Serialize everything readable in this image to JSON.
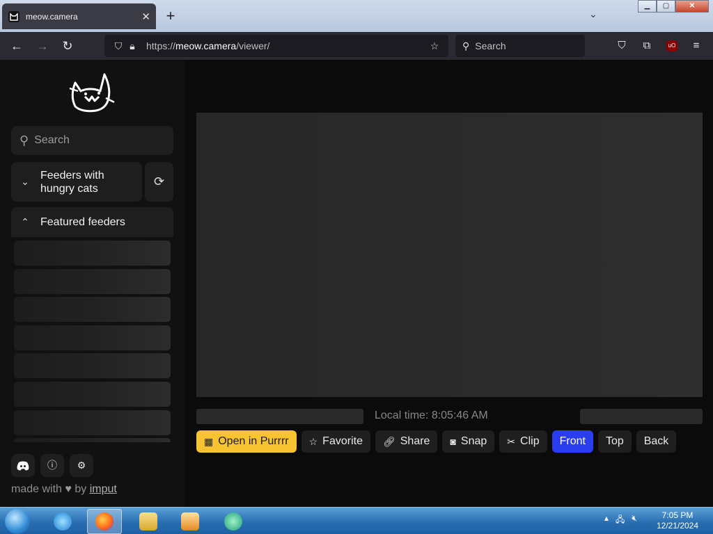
{
  "browser": {
    "tab_title": "meow.camera",
    "url_scheme": "https://",
    "url_host": "meow.camera",
    "url_path": "/viewer/",
    "search_placeholder": "Search"
  },
  "sidebar": {
    "search_placeholder": "Search",
    "sections": [
      {
        "label": "Feeders with hungry cats",
        "expanded": false
      },
      {
        "label": "Featured feeders",
        "expanded": true
      }
    ],
    "credit_prefix": "made with",
    "credit_by": "by",
    "credit_author": "imput"
  },
  "viewer": {
    "local_time": "Local time: 8:05:46 AM",
    "actions": [
      {
        "label": "Open in Purrrr",
        "icon": "qr-code-icon"
      },
      {
        "label": "Favorite",
        "icon": "star-icon"
      },
      {
        "label": "Share",
        "icon": "link-icon"
      },
      {
        "label": "Snap",
        "icon": "camera-icon"
      },
      {
        "label": "Clip",
        "icon": "scissors-icon"
      },
      {
        "label": "Front",
        "icon": null,
        "active": true
      },
      {
        "label": "Top",
        "icon": null
      },
      {
        "label": "Back",
        "icon": null
      }
    ]
  },
  "taskbar": {
    "time": "7:05 PM",
    "date": "12/21/2024"
  },
  "colors": {
    "accent_yellow": "#f7c331",
    "accent_blue": "#2a3ef0",
    "background": "#0b0b0b"
  }
}
